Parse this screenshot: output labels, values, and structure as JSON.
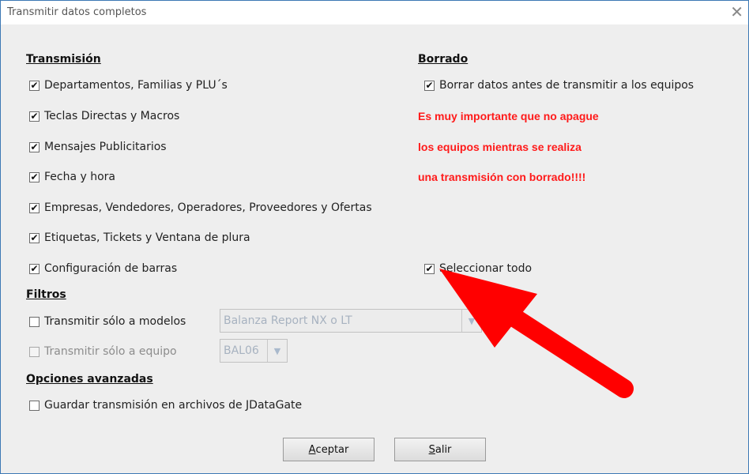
{
  "window": {
    "title": "Transmitir datos completos",
    "close_glyph": "✕"
  },
  "transmision": {
    "heading": "Transmisión",
    "items": [
      {
        "label": "Departamentos, Familias y PLU´s",
        "checked": true
      },
      {
        "label": "Teclas Directas y Macros",
        "checked": true
      },
      {
        "label": "Mensajes Publicitarios",
        "checked": true
      },
      {
        "label": "Fecha y hora",
        "checked": true
      },
      {
        "label": "Empresas, Vendedores, Operadores, Proveedores y Ofertas",
        "checked": true
      },
      {
        "label": "Etiquetas, Tickets y Ventana de plura",
        "checked": true
      },
      {
        "label": "Configuración de barras",
        "checked": true
      }
    ]
  },
  "borrado": {
    "heading": "Borrado",
    "item": {
      "label": "Borrar datos antes de transmitir a los equipos",
      "checked": true
    },
    "warning_lines": [
      "Es muy importante que no apague",
      "los equipos mientras se realiza",
      "una transmisión con borrado!!!!"
    ],
    "warning_color": "#ff1a1a"
  },
  "seleccionar_todo": {
    "label": "Seleccionar todo",
    "checked": true
  },
  "filtros": {
    "heading": "Filtros",
    "modelos": {
      "label": "Transmitir sólo a modelos",
      "checked": false,
      "value": "Balanza Report NX o LT"
    },
    "equipo": {
      "label": "Transmitir sólo a equipo",
      "checked": false,
      "value": "BAL06"
    }
  },
  "avanzadas": {
    "heading": "Opciones avanzadas",
    "item": {
      "label": "Guardar transmisión en archivos de JDataGate",
      "checked": false
    }
  },
  "buttons": {
    "aceptar": {
      "mnemonic": "A",
      "rest": "ceptar"
    },
    "salir": {
      "mnemonic": "S",
      "rest": "alir"
    }
  },
  "icons": {
    "check": "check-icon",
    "dropdown": "chevron-down-icon",
    "annotation": "red-arrow-annotation"
  },
  "colors": {
    "accent_border": "#3c78b4",
    "annotation_red": "#ff0000"
  }
}
